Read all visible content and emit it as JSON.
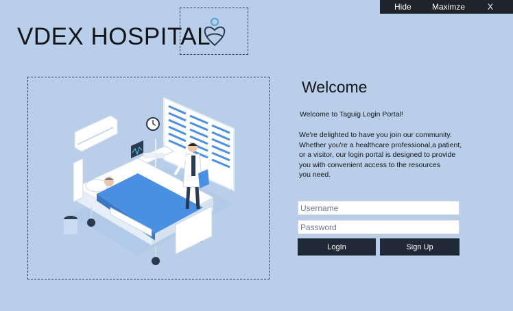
{
  "window": {
    "hide_label": "Hide",
    "maximize_label": "Maximze",
    "close_label": "X"
  },
  "brand": {
    "title": "VDEX HOSPITAL",
    "logo_icon": "heart-person-icon",
    "logo_color": "#5aa5dc"
  },
  "illustration": {
    "icon": "hospital-bed-doctor-illustration"
  },
  "welcome": {
    "title": "Welcome",
    "subtitle": "Welcome to Taguig Login Portal!",
    "body": "We're delighted to have you join our community.\nWhether you're a healthcare professional,a patient,\nor a visitor, our login portal is designed to provide\nyou with convenient access to the resources\nyou need."
  },
  "form": {
    "username_placeholder": "Username",
    "password_placeholder": "Password",
    "login_label": "LogIn",
    "signup_label": "Sign Up"
  },
  "colors": {
    "background": "#b9cfe9",
    "titlebar": "#1f2429",
    "button": "#1f2a36",
    "accent_blue": "#4a90e2"
  }
}
